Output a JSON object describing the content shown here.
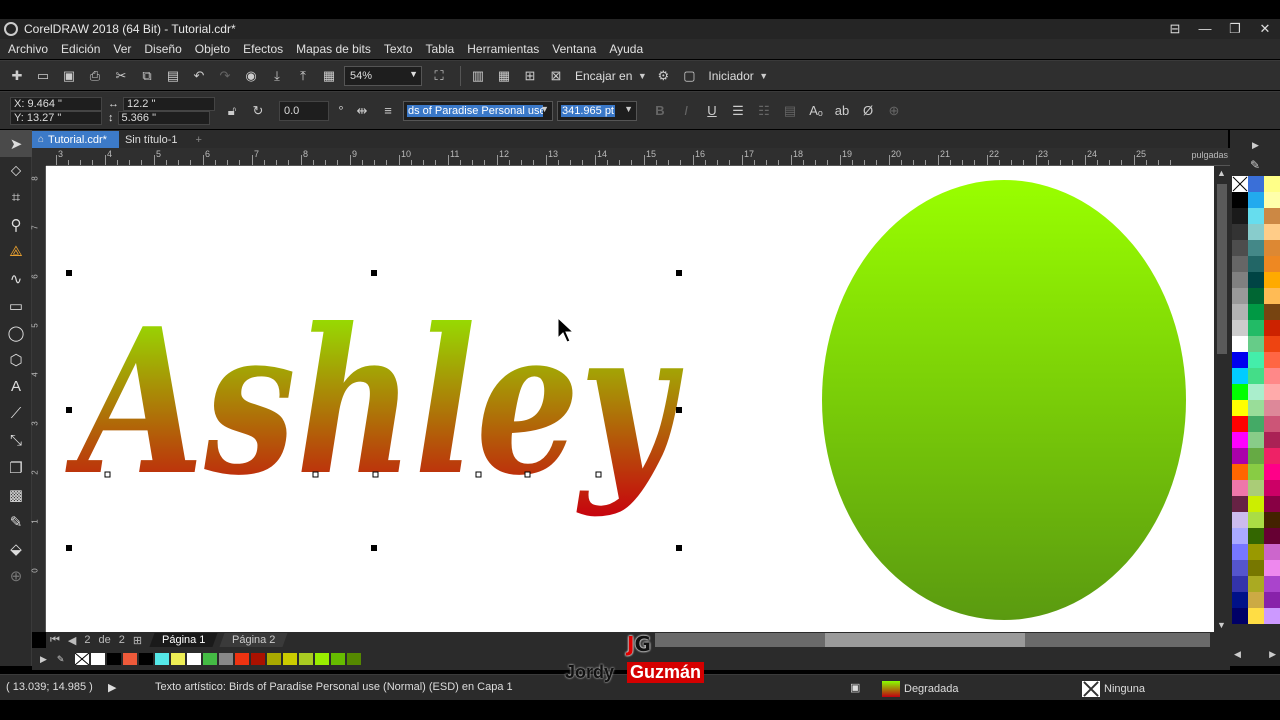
{
  "titlebar": {
    "title": "CorelDRAW 2018 (64 Bit) - Tutorial.cdr*",
    "buttons": [
      "⊟",
      "—",
      "❐",
      "✕"
    ]
  },
  "menu": [
    "Archivo",
    "Edición",
    "Ver",
    "Diseño",
    "Objeto",
    "Efectos",
    "Mapas de bits",
    "Texto",
    "Tabla",
    "Herramientas",
    "Ventana",
    "Ayuda"
  ],
  "toolbar": {
    "zoom": "54%",
    "snap_label": "Encajar en",
    "launcher_label": "Iniciador"
  },
  "propbar": {
    "x": "X: 9.464 \"",
    "y": "Y: 13.27 \"",
    "width": "12.2 \"",
    "height": "5.366 \"",
    "rotation": "0.0",
    "font": "ds of Paradise  Personal use",
    "font_size": "341.965 pt"
  },
  "doc_tabs": [
    "Tutorial.cdr*",
    "Sin título-1",
    "+"
  ],
  "ruler": {
    "h_numbers": [
      "3",
      "4",
      "5",
      "6",
      "7",
      "8",
      "9",
      "10",
      "11",
      "12",
      "13",
      "14",
      "15",
      "16",
      "17",
      "18",
      "19",
      "20",
      "21",
      "22",
      "23",
      "24",
      "25"
    ],
    "v_numbers": [
      "8",
      "7",
      "6",
      "5",
      "4",
      "3",
      "2",
      "1",
      "0"
    ],
    "unit": "pulgadas"
  },
  "canvas": {
    "text": "Ashley",
    "gradient": {
      "top": "#8fff00",
      "bottom": "#c8000e"
    },
    "ellipse_gradient": {
      "top": "#99ff00",
      "bottom": "#5a9a10"
    }
  },
  "pages": {
    "counter": "2",
    "of": "de",
    "total": "2",
    "tabs": [
      "Página 1",
      "Página 2"
    ]
  },
  "doc_palette": [
    "#ffffff",
    "#000000",
    "#ee5a3a",
    "#000000",
    "#55e8e8",
    "#eeee55",
    "#ffffff",
    "#44bb44",
    "#888888",
    "#ee3311",
    "#aa1100",
    "#aaaa00",
    "#cccc00",
    "#aacc22",
    "#99ee00",
    "#66bb00",
    "#558800"
  ],
  "color_palette": [
    "none",
    "#3a6fd8",
    "#ffff88",
    "#000000",
    "#22aaee",
    "#ffffaa",
    "#1a1a1a",
    "#66ddee",
    "#cc8844",
    "#333333",
    "#88cccc",
    "#ffcc88",
    "#4d4d4d",
    "#448888",
    "#dd8833",
    "#666666",
    "#226666",
    "#ee8822",
    "#808080",
    "#004444",
    "#ffaa00",
    "#999999",
    "#006633",
    "#ffbb55",
    "#b3b3b3",
    "#009944",
    "#774411",
    "#cccccc",
    "#22bb66",
    "#cc2200",
    "#ffffff",
    "#66cc88",
    "#ee4411",
    "#0000ee",
    "#44eeaa",
    "#ff6644",
    "#00ccff",
    "#44dd88",
    "#ff8888",
    "#00ff00",
    "#aaeecc",
    "#ffaaaa",
    "#ffff00",
    "#99dd99",
    "#dd8899",
    "#ff0000",
    "#44aa66",
    "#cc5577",
    "#ff00ff",
    "#88cc88",
    "#aa2255",
    "#aa00aa",
    "#66aa44",
    "#ee2266",
    "#ff6600",
    "#88cc44",
    "#ff0088",
    "#ee77aa",
    "#aacc77",
    "#cc0066",
    "#662244",
    "#ccee00",
    "#880044",
    "#ccbbee",
    "#aadd44",
    "#442200",
    "#aaaaff",
    "#336600",
    "#660033",
    "#7777ff",
    "#999900",
    "#cc66cc",
    "#5555cc",
    "#777700",
    "#ee88ee",
    "#3333aa",
    "#aaaa22",
    "#aa44cc",
    "#001188",
    "#ccaa44",
    "#8822aa",
    "#000066",
    "#ffdd44",
    "#cc99ff"
  ],
  "status": {
    "cursor": "( 13.039; 14.985 )",
    "info": "Texto artístico: Birds of Paradise  Personal use (Normal) (ESD) en Capa 1",
    "fill": "Degradada",
    "outline": "Ninguna"
  },
  "watermark": {
    "logo": "JG",
    "first": "Jordy",
    "last": "Guzmán"
  }
}
